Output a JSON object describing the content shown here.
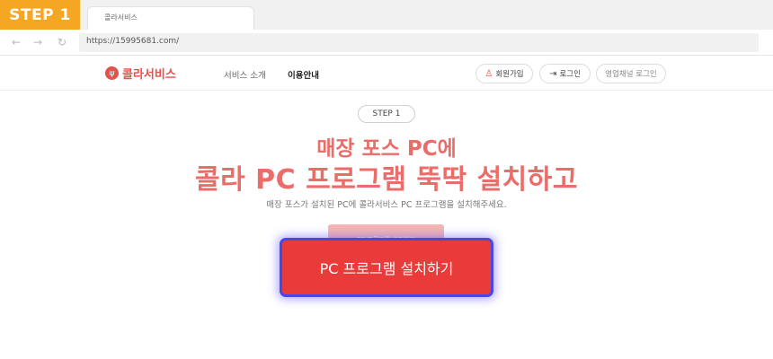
{
  "step_badge": "STEP 1",
  "browser": {
    "tab_title": "콜라서비스",
    "url": "https://15995681.com/",
    "icons": [
      "arrow-left-icon",
      "arrow-right-icon",
      "refresh-icon"
    ]
  },
  "header": {
    "logo_text": "콜라서비스",
    "nav": [
      "서비스 소개",
      "이용안내"
    ],
    "active_nav": "이용안내",
    "buttons": {
      "signup": "회원가입",
      "login": "로그인",
      "sales_login": "영업채널 로그인"
    }
  },
  "hero": {
    "step_label": "STEP 1",
    "headline_line1": "매장 포스 PC에",
    "headline_line2": "콜라 PC 프로그램 뚝딱 설치하고",
    "subtext": "매장 포스가 설치된 PC에 콜라서비스 PC 프로그램을 설치해주세요.",
    "ghost_button": "PC 프로그램 설치하기",
    "install_button": "PC 프로그램 설치하기"
  },
  "colors": {
    "brand": "#ea3b3b",
    "headline": "#ea6d69",
    "step_badge": "#f5a623",
    "highlight_border": "#4b46e6"
  }
}
